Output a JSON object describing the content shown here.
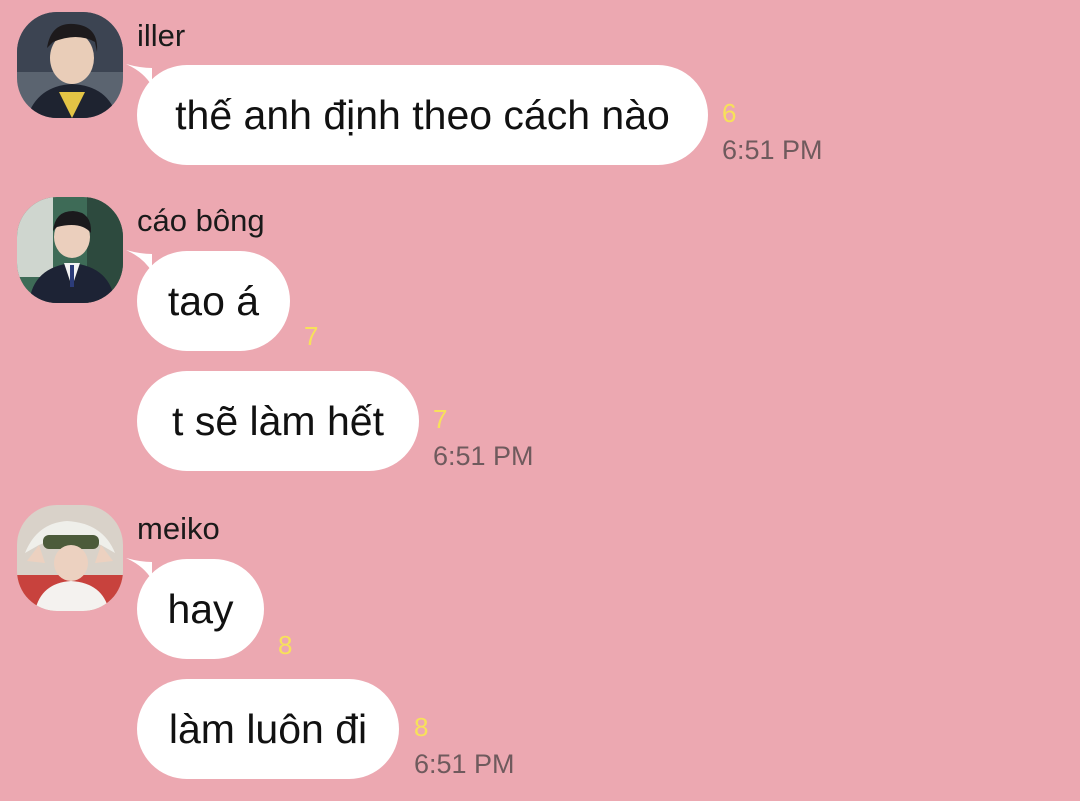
{
  "groups": [
    {
      "sender": "iller",
      "messages": [
        {
          "text": "thế anh định theo cách nào",
          "unread": "6",
          "time": "6:51 PM"
        }
      ]
    },
    {
      "sender": "cáo bông",
      "messages": [
        {
          "text": "tao á",
          "unread": "7"
        },
        {
          "text": "t sẽ làm hết",
          "unread": "7",
          "time": "6:51 PM"
        }
      ]
    },
    {
      "sender": "meiko",
      "messages": [
        {
          "text": "hay",
          "unread": "8"
        },
        {
          "text": "làm luôn đi",
          "unread": "8",
          "time": "6:51 PM"
        }
      ]
    }
  ],
  "colors": {
    "background": "#eca8b1",
    "bubble": "#ffffff",
    "unread_count": "#f7e15a",
    "timestamp": "#6f5a5d"
  }
}
